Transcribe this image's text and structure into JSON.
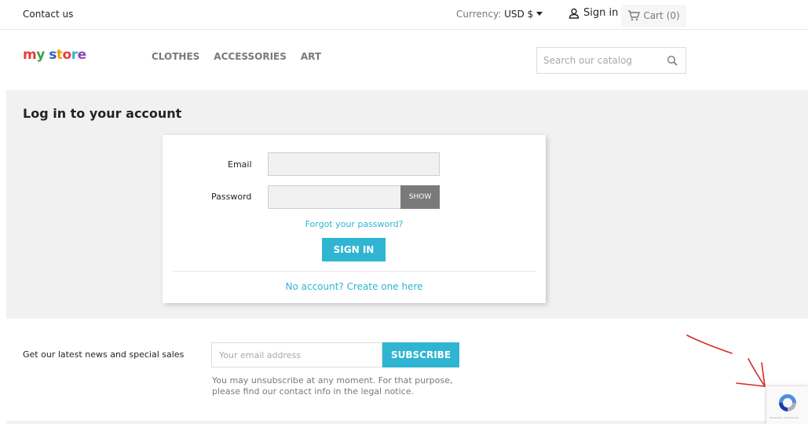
{
  "topbar": {
    "contact_label": "Contact us",
    "currency_prefix": "Currency: ",
    "currency_value": "USD $",
    "signin_label": "Sign in",
    "cart_label": "Cart",
    "cart_count": "(0)"
  },
  "header": {
    "logo_letters": [
      "m",
      "y",
      " ",
      "s",
      "t",
      "o",
      "r",
      "e"
    ],
    "logo_text": "my store",
    "menu": [
      "CLOTHES",
      "ACCESSORIES",
      "ART"
    ],
    "search_placeholder": "Search our catalog"
  },
  "login": {
    "page_title": "Log in to your account",
    "email_label": "Email",
    "email_value": "",
    "password_label": "Password",
    "password_value": "",
    "show_label": "SHOW",
    "forgot_label": "Forgot your password?",
    "signin_button": "SIGN IN",
    "create_account_label": "No account? Create one here"
  },
  "newsletter": {
    "label": "Get our latest news and special sales",
    "placeholder": "Your email address",
    "subscribe_label": "SUBSCRIBE",
    "disclaimer": "You may unsubscribe at any moment. For that purpose, please find our contact info in the legal notice."
  },
  "recaptcha": {
    "text": "Privacidad - Condiciones"
  },
  "icons": {
    "user": "user-icon",
    "cart": "cart-icon",
    "search": "search-icon",
    "caret": "caret-down-icon",
    "recaptcha": "recaptcha-icon",
    "arrow": "red-arrow-annotation"
  },
  "colors": {
    "accent": "#2fb5d2",
    "background_grey": "#f1f1f1",
    "annotation": "#d62a2a"
  }
}
